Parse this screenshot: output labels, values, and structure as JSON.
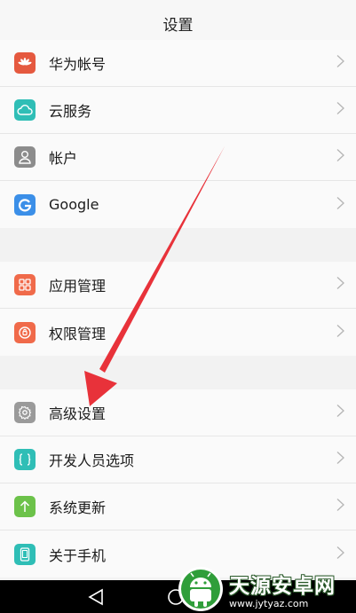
{
  "header": {
    "title": "设置"
  },
  "groups": [
    {
      "items": [
        {
          "label": "华为帐号",
          "icon": "huawei-icon",
          "color": "#e5593f"
        },
        {
          "label": "云服务",
          "icon": "cloud-icon",
          "color": "#2fbeb6"
        },
        {
          "label": "帐户",
          "icon": "user-icon",
          "color": "#8c8c8c"
        },
        {
          "label": "Google",
          "icon": "google-icon",
          "color": "#3b8fe8"
        }
      ]
    },
    {
      "items": [
        {
          "label": "应用管理",
          "icon": "apps-grid-icon",
          "color": "#f06a4a"
        },
        {
          "label": "权限管理",
          "icon": "permission-icon",
          "color": "#f06a4a"
        }
      ]
    },
    {
      "items": [
        {
          "label": "高级设置",
          "icon": "gear-icon",
          "color": "#9a9a9a"
        },
        {
          "label": "开发人员选项",
          "icon": "braces-icon",
          "color": "#2fbeb6"
        },
        {
          "label": "系统更新",
          "icon": "update-arrow-icon",
          "color": "#6cc24a"
        },
        {
          "label": "关于手机",
          "icon": "phone-icon",
          "color": "#2fbeb6"
        }
      ]
    }
  ],
  "watermark": {
    "title": "天源安卓网",
    "url": "www.jytyaz.com"
  },
  "colors": {
    "arrow": "#e8323a"
  }
}
